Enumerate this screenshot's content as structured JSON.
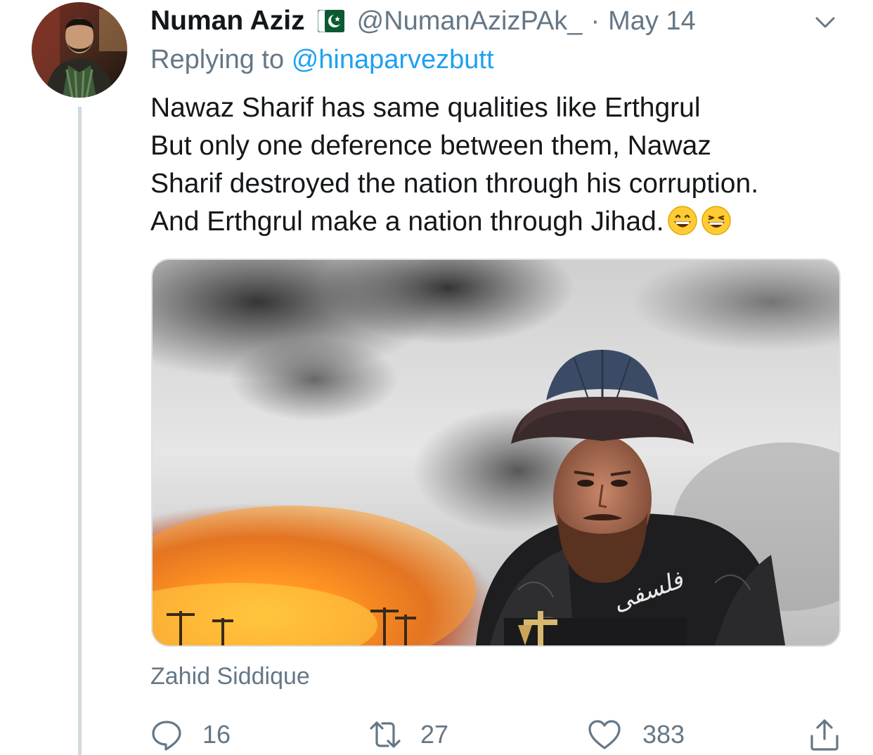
{
  "tweet": {
    "author": {
      "display_name": "Numan Aziz",
      "flag_icon": "pakistan-flag-icon",
      "handle": "@NumanAzizPAk_",
      "separator": "·",
      "date": "May 14"
    },
    "replying_prefix": "Replying to",
    "replying_to": "@hinaparvezbutt",
    "text_lines": [
      "Nawaz Sharif has same qualities like Erthgrul",
      "But only one deference between them, Nawaz",
      "Sharif destroyed the nation through his corruption.",
      "And Erthgrul make a nation through Jihad."
    ],
    "emojis": [
      "grinning-face-icon",
      "grinning-squinting-face-icon"
    ],
    "image_watermark": "فلسفی",
    "media_credit": "Zahid Siddique",
    "actions": {
      "reply_count": "16",
      "retweet_count": "27",
      "like_count": "383"
    }
  },
  "colors": {
    "text_primary": "#14171a",
    "text_secondary": "#657786",
    "link": "#1da1f2",
    "thread_line": "#cfd9de"
  }
}
